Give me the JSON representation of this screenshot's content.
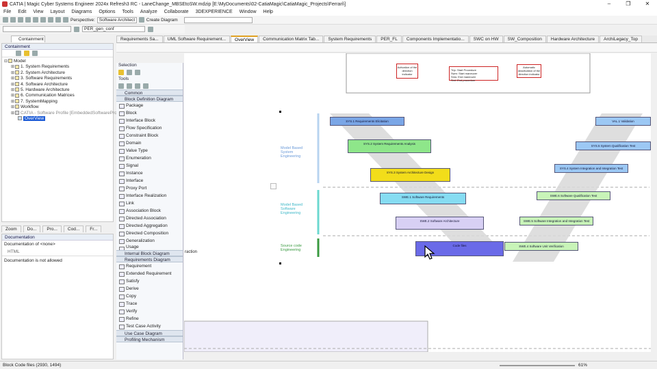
{
  "window": {
    "title": "CATIA | Magic Cyber Systems Engineer 2024x Refresh3 RC - LaneChange_MBSEtoSW.mdzip [E:\\MyDocuments\\02-CatiaMagic\\CatiaMagic_Projects\\Ferrari\\]",
    "minimize": "–",
    "maximize": "❐",
    "close": "✕"
  },
  "menu": [
    "File",
    "Edit",
    "View",
    "Layout",
    "Diagrams",
    "Options",
    "Tools",
    "Analyze",
    "Collaborate",
    "3DEXPERIENCE",
    "Window",
    "Help"
  ],
  "toolbar": {
    "perspective_label": "Perspective:",
    "perspective_value": "Software Architect",
    "create_diagram": "Create Diagram",
    "config_value": "PER_gen_conf"
  },
  "containment": {
    "tab": "Containment",
    "header": "Containment",
    "tree": [
      {
        "label": "Model",
        "level": 0
      },
      {
        "label": "1. System Requirements",
        "level": 1
      },
      {
        "label": "2. System Architecture",
        "level": 1
      },
      {
        "label": "3. Software Requirements",
        "level": 1
      },
      {
        "label": "4. Software Architecture",
        "level": 1
      },
      {
        "label": "5. Hardware Architecture",
        "level": 1
      },
      {
        "label": "6. Communication Matrices",
        "level": 1
      },
      {
        "label": "7. SystemMapping",
        "level": 1
      },
      {
        "label": "Workflow",
        "level": 1
      },
      {
        "label": "CATIA - Software Profile [EmbeddedSoftwareProfile]",
        "level": 1
      },
      {
        "label": "OverView",
        "level": 2
      }
    ],
    "bottom_tabs": [
      "Zoom",
      "Do...",
      "Pro...",
      "Cod...",
      "Fr..."
    ]
  },
  "documentation": {
    "header": "Documentation",
    "of_label": "Documentation of <none>",
    "html_label": "HTML",
    "message": "Documentation is not allowed"
  },
  "palette": {
    "selection": "Selection",
    "tools": "Tools",
    "common": "Common",
    "bdd": "Block Definition Diagram",
    "items": [
      "Package",
      "Block",
      "Interface Block",
      "Flow Specification",
      "Constraint Block",
      "Domain",
      "Value Type",
      "Enumeration",
      "Signal",
      "Instance",
      "Interface",
      "Proxy Port",
      "Interface Realization",
      "Link",
      "Association Block",
      "Directed Association",
      "Directed Aggregation",
      "Directed Composition",
      "Generalization",
      "Usage"
    ],
    "ibd": "Internal Block Diagram",
    "req": "Requirements Diagram",
    "req_items": [
      "Requirement",
      "Extended Requirement",
      "Satisfy",
      "Derive",
      "Copy",
      "Trace",
      "Verify",
      "Refine",
      "Test Case Activity"
    ],
    "ucd": "Use Case Diagram",
    "prof": "Profiling Mechanism"
  },
  "tabs": [
    "Requirements Sa...",
    "UML Software Requirement...",
    "OverView",
    "Communication Matrix Tab...",
    "System Requirements",
    "PER_FL",
    "Components Implementatio...",
    "SWC on HW",
    "SW_Composition",
    "Hardware Architecture",
    "ArchiLegacy_Top"
  ],
  "active_tab": "OverView",
  "diagram": {
    "top_boxes": [
      "Activation of the direction indicator",
      "Trip: Start Procedure\nSwm: Start maneuver\nSms: End maneuver\nSmi: End procedure",
      "Automatic deactivation of the direction indicator"
    ],
    "side_labels": [
      "Model Based System Engineering",
      "Model Based Software Engineering",
      "Source code Engineering"
    ],
    "left_bars": [
      "SYS.1 Requirements Elicitation",
      "SYS.2 System Requirements Analysis",
      "SYS.3 System Architecture Design",
      "SWE.1 Software Requirements",
      "SWE.2 Software Architecture",
      "Code files"
    ],
    "right_bars": [
      "VAL.1 Validation",
      "SYS.5 System Qualification Test",
      "SYS.4 System Integration and Integration Test",
      "SWE.6 Software Qualification Test",
      "SWE.5 Software Integration and Integration Test",
      "SWE.4 Software Unit Verification"
    ],
    "fragment": "raction"
  },
  "status": {
    "text": "Block Code files (2930, 1494)",
    "zoom": "61%"
  },
  "colors": {
    "sys1": "#7aa6e6",
    "sys2": "#8ee68a",
    "sys3": "#f2dd1a",
    "swe1": "#86dcf2",
    "swe2": "#d8d0f4",
    "code": "#6a6ae8",
    "right": "#9cc8f4",
    "right_green": "#c8f4b8"
  }
}
